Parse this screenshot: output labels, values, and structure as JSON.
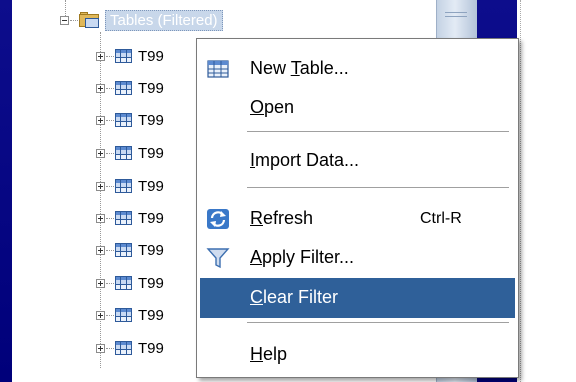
{
  "navigator": {
    "folder": {
      "label": "Tables (Filtered)",
      "expanded": true
    },
    "tables": [
      {
        "label": "T99"
      },
      {
        "label": "T99"
      },
      {
        "label": "T99"
      },
      {
        "label": "T99"
      },
      {
        "label": "T99"
      },
      {
        "label": "T99"
      },
      {
        "label": "T99"
      },
      {
        "label": "T99"
      },
      {
        "label": "T99"
      },
      {
        "label": "T99"
      }
    ]
  },
  "context_menu": {
    "new_table": {
      "before": "New ",
      "mnemonic": "T",
      "after": "able...",
      "icon": "table-icon"
    },
    "open": {
      "before": "",
      "mnemonic": "O",
      "after": "pen"
    },
    "import_data": {
      "before": "",
      "mnemonic": "I",
      "after": "mport Data..."
    },
    "refresh": {
      "before": "",
      "mnemonic": "R",
      "after": "efresh",
      "shortcut": "Ctrl-R",
      "icon": "refresh-icon"
    },
    "apply_filter": {
      "before": "",
      "mnemonic": "A",
      "after": "pply Filter...",
      "icon": "funnel-icon"
    },
    "clear_filter": {
      "before": "",
      "mnemonic": "C",
      "after": "lear Filter",
      "highlighted": true
    },
    "help": {
      "before": "",
      "mnemonic": "H",
      "after": "elp"
    }
  },
  "colors": {
    "desktop": "#000080",
    "menu_highlight": "#2f6099",
    "folder_selection": "#c8d7ea"
  }
}
